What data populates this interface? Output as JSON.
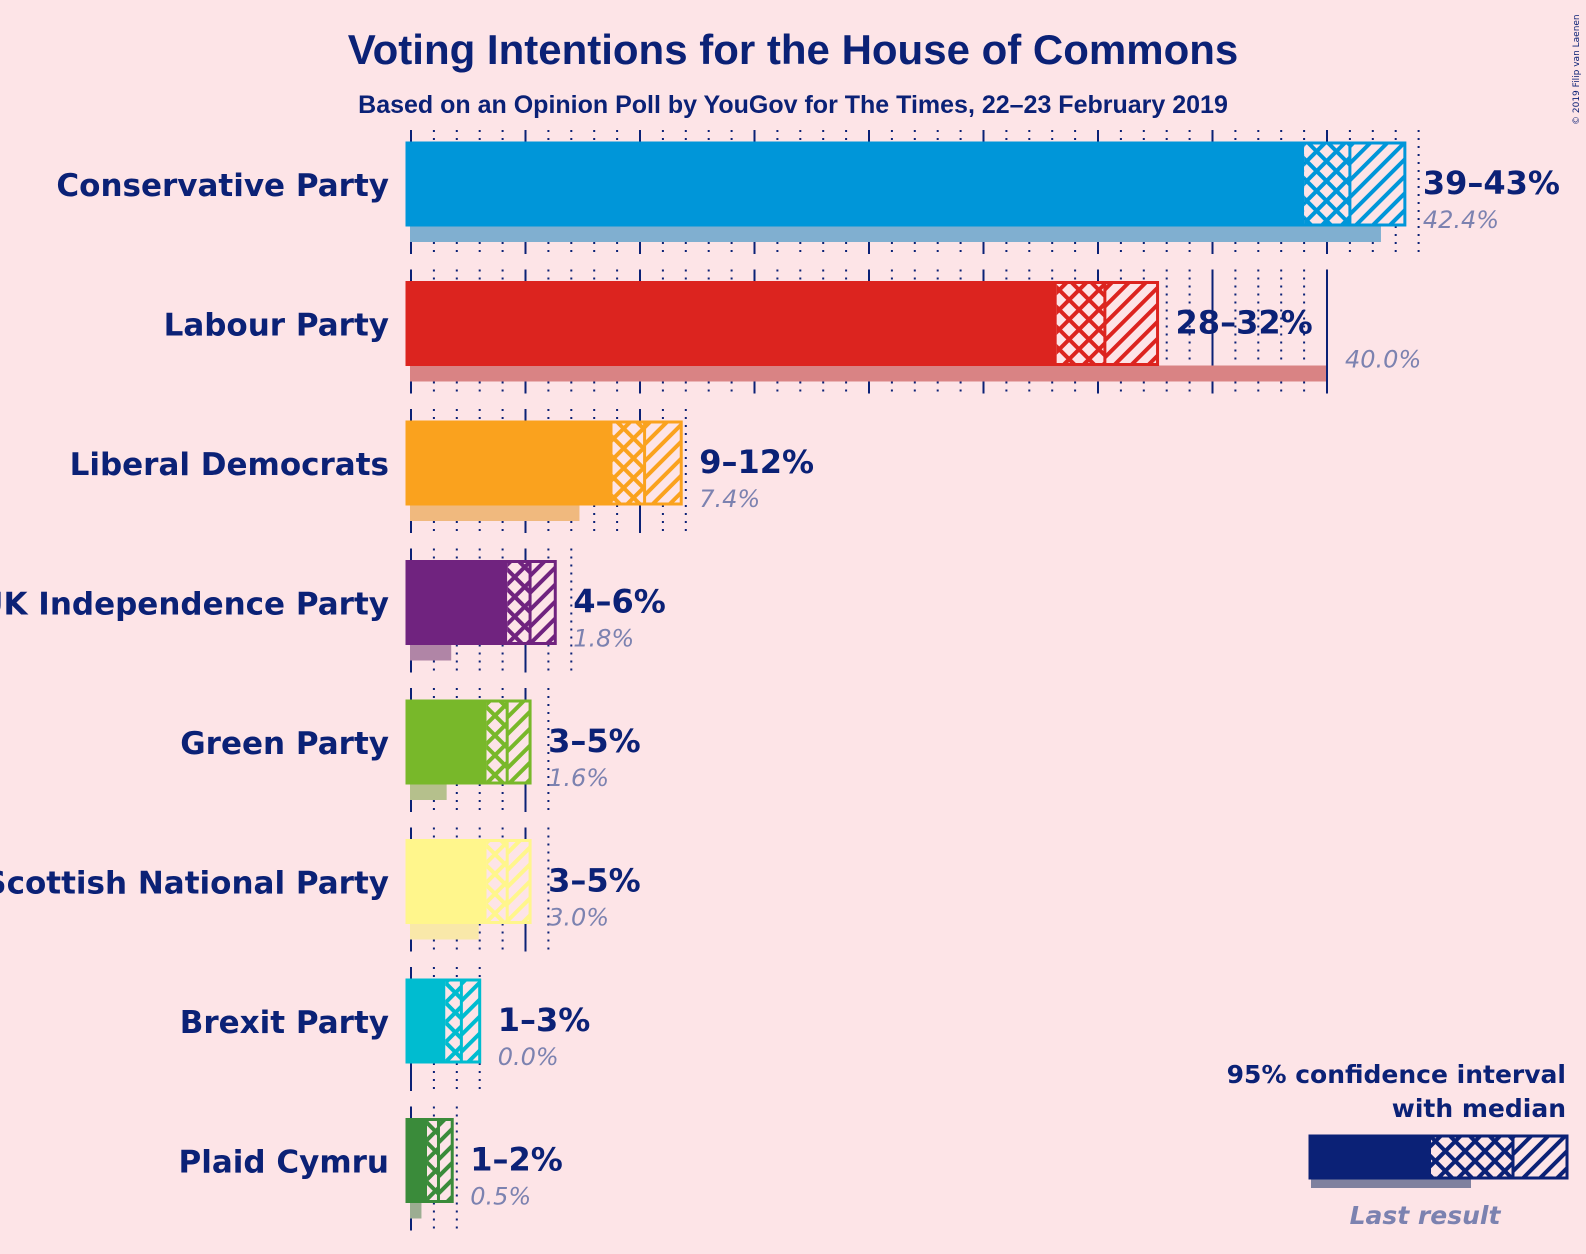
{
  "chart_data": {
    "type": "bar",
    "orientation": "horizontal",
    "title": "Voting Intentions for the House of Commons",
    "subtitle": "Based on an Opinion Poll by YouGov for The Times, 22–23 February 2019",
    "copyright": "© 2019 Filip van Laenen",
    "xlabel": "",
    "ylabel": "",
    "xlim": [
      0,
      45
    ],
    "major_tick_step": 5,
    "minor_tick_step": 1,
    "grid": true,
    "legend": {
      "placement": "bottom-right",
      "title_line1": "95% confidence interval",
      "title_line2": "with median",
      "last_result_label": "Last result",
      "color": "#0b2176",
      "last_color": "#7f819f"
    },
    "series": [
      {
        "name": "Conservative Party",
        "ci_low": 39,
        "median": 41,
        "ci_high": 43.4,
        "last": 42.4,
        "range_label": "39–43%",
        "last_label": "42.4%",
        "color": "#0096d9",
        "last_color": "#80afd0"
      },
      {
        "name": "Labour Party",
        "ci_low": 28.2,
        "median": 30.3,
        "ci_high": 32.6,
        "last": 40.0,
        "range_label": "28–32%",
        "last_label": "40.0%",
        "color": "#dc241f",
        "last_color": "#d98384"
      },
      {
        "name": "Liberal Democrats",
        "ci_low": 8.8,
        "median": 10.2,
        "ci_high": 11.8,
        "last": 7.4,
        "range_label": "9–12%",
        "last_label": "7.4%",
        "color": "#faa21e",
        "last_color": "#f0b97e"
      },
      {
        "name": "UK Independence Party",
        "ci_low": 4.2,
        "median": 5.2,
        "ci_high": 6.3,
        "last": 1.8,
        "range_label": "4–6%",
        "last_label": "1.8%",
        "color": "#70237f",
        "last_color": "#b085a6"
      },
      {
        "name": "Green Party",
        "ci_low": 3.3,
        "median": 4.2,
        "ci_high": 5.2,
        "last": 1.6,
        "range_label": "3–5%",
        "last_label": "1.6%",
        "color": "#78b82a",
        "last_color": "#b5c08c"
      },
      {
        "name": "Scottish National Party",
        "ci_low": 3.3,
        "median": 4.2,
        "ci_high": 5.2,
        "last": 3.0,
        "range_label": "3–5%",
        "last_label": "3.0%",
        "color": "#fff68c",
        "last_color": "#f9e8a9"
      },
      {
        "name": "Brexit Party",
        "ci_low": 1.5,
        "median": 2.2,
        "ci_high": 3.0,
        "last": 0.0,
        "range_label": "1–3%",
        "last_label": "0.0%",
        "color": "#00bcd0",
        "last_color": "#80c7d5"
      },
      {
        "name": "Plaid Cymru",
        "ci_low": 0.7,
        "median": 1.2,
        "ci_high": 1.8,
        "last": 0.5,
        "range_label": "1–2%",
        "last_label": "0.5%",
        "color": "#3a8b3a",
        "last_color": "#9cad92"
      }
    ]
  }
}
